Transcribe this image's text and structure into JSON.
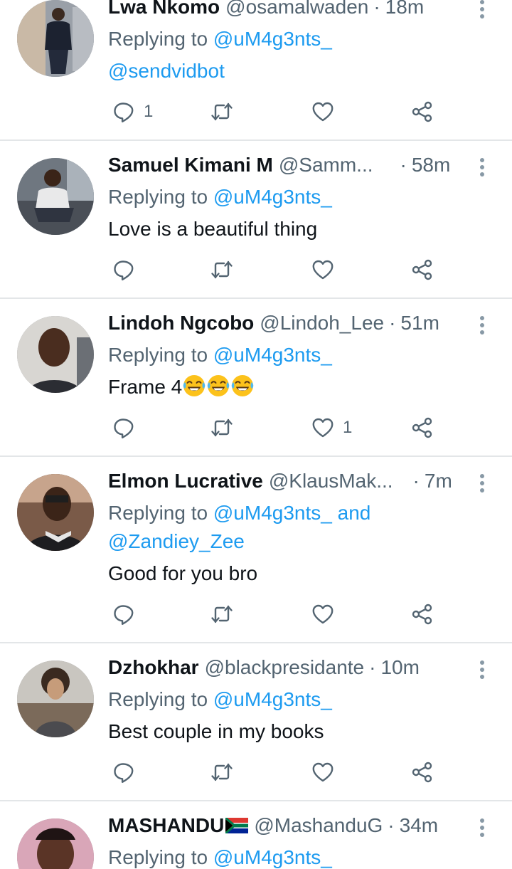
{
  "colors": {
    "text": "#0f1419",
    "muted": "#536471",
    "link": "#1d9bf0",
    "divider": "#e3e6e8"
  },
  "tweets": [
    {
      "name": "Lwa Nkomo",
      "handle": "@osamalwaden",
      "dot": "·",
      "time": "18m",
      "replying_prefix": "Replying to ",
      "replying_to": "@uM4g3nts_",
      "body_link": "@sendvidbot",
      "reply_count": "1",
      "retweet_count": "",
      "like_count": ""
    },
    {
      "name": "Samuel Kimani M",
      "handle": "@Samm...",
      "dot": "·",
      "time": "58m",
      "replying_prefix": "Replying to ",
      "replying_to": "@uM4g3nts_",
      "body": "Love is a beautiful thing",
      "reply_count": "",
      "retweet_count": "",
      "like_count": ""
    },
    {
      "name": "Lindoh Ngcobo",
      "handle": "@Lindoh_Lee",
      "dot": "·",
      "time": "51m",
      "replying_prefix": "Replying to ",
      "replying_to": "@uM4g3nts_",
      "body": "Frame 4",
      "body_emoji": "face-with-tears-of-joy",
      "reply_count": "",
      "retweet_count": "",
      "like_count": "1"
    },
    {
      "name": "Elmon Lucrative",
      "handle": "@KlausMak...",
      "dot": "·",
      "time": "7m",
      "replying_prefix": "Replying to ",
      "replying_to": "@uM4g3nts_ and",
      "replying_to_2": "@Zandiey_Zee",
      "body": "Good for you bro",
      "reply_count": "",
      "retweet_count": "",
      "like_count": ""
    },
    {
      "name": "Dzhokhar",
      "handle": "@blackpresidante",
      "dot": "·",
      "time": "10m",
      "replying_prefix": "Replying to ",
      "replying_to": "@uM4g3nts_",
      "body": "Best couple in my books",
      "reply_count": "",
      "retweet_count": "",
      "like_count": ""
    },
    {
      "name": "MASHANDU",
      "name_flag": "south-africa-flag",
      "handle": "@MashanduG",
      "dot": "·",
      "time": "34m",
      "replying_prefix": "Replying to ",
      "replying_to": "@uM4g3nts_"
    }
  ],
  "icons": {
    "reply": "reply-icon",
    "retweet": "retweet-icon",
    "like": "heart-icon",
    "share": "share-icon",
    "more": "more-options-icon"
  }
}
